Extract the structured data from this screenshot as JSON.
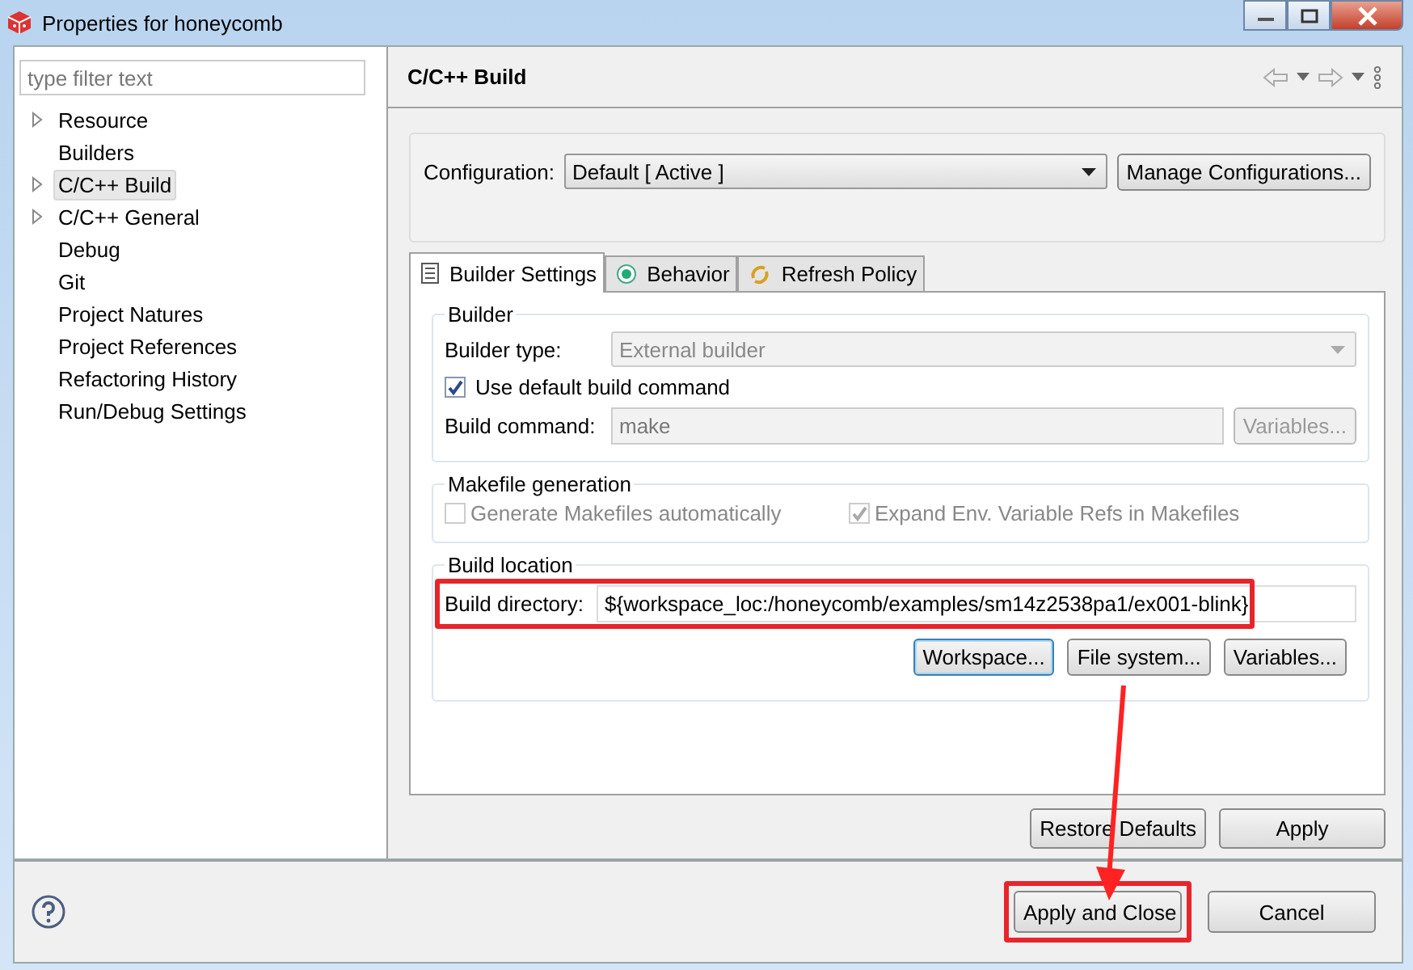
{
  "window": {
    "title": "Properties for honeycomb"
  },
  "filter": {
    "placeholder": "type filter text"
  },
  "tree": [
    {
      "label": "Resource",
      "expandable": true,
      "selected": false
    },
    {
      "label": "Builders",
      "expandable": false,
      "selected": false
    },
    {
      "label": "C/C++ Build",
      "expandable": true,
      "selected": true
    },
    {
      "label": "C/C++ General",
      "expandable": true,
      "selected": false
    },
    {
      "label": "Debug",
      "expandable": false,
      "selected": false
    },
    {
      "label": "Git",
      "expandable": false,
      "selected": false
    },
    {
      "label": "Project Natures",
      "expandable": false,
      "selected": false
    },
    {
      "label": "Project References",
      "expandable": false,
      "selected": false
    },
    {
      "label": "Refactoring History",
      "expandable": false,
      "selected": false
    },
    {
      "label": "Run/Debug Settings",
      "expandable": false,
      "selected": false
    }
  ],
  "page": {
    "title": "C/C++ Build",
    "configuration": {
      "label": "Configuration:",
      "value": "Default  [ Active ]",
      "button": "Manage Configurations..."
    },
    "tabs": [
      {
        "label": "Builder Settings",
        "kind": "list",
        "selected": true
      },
      {
        "label": "Behavior",
        "kind": "radio",
        "selected": false
      },
      {
        "label": "Refresh Policy",
        "kind": "refresh",
        "selected": false
      }
    ],
    "builder": {
      "title": "Builder",
      "type_label": "Builder type:",
      "type_value": "External builder",
      "use_default": {
        "label": "Use default build command",
        "checked": true
      },
      "command_label": "Build command:",
      "command_value": "make",
      "variables": "Variables..."
    },
    "makefile": {
      "title": "Makefile generation",
      "options": [
        {
          "label": "Generate Makefiles automatically",
          "checked": false,
          "disabled": true
        },
        {
          "label": "Expand Env. Variable Refs in Makefiles",
          "checked": true,
          "disabled": true
        }
      ]
    },
    "location": {
      "title": "Build location",
      "dir_label": "Build directory:",
      "dir_value": "${workspace_loc:/honeycomb/examples/sm14z2538pa1/ex001-blink}",
      "highlighted": true,
      "buttons": [
        {
          "label": "Workspace...",
          "focused": true
        },
        {
          "label": "File system...",
          "focused": false
        },
        {
          "label": "Variables...",
          "focused": false
        }
      ]
    },
    "restore": "Restore Defaults",
    "apply": "Apply"
  },
  "footer": {
    "buttons": [
      {
        "label": "Apply and Close",
        "highlighted": true
      },
      {
        "label": "Cancel",
        "highlighted": false
      }
    ]
  },
  "annotation_arrow": true
}
